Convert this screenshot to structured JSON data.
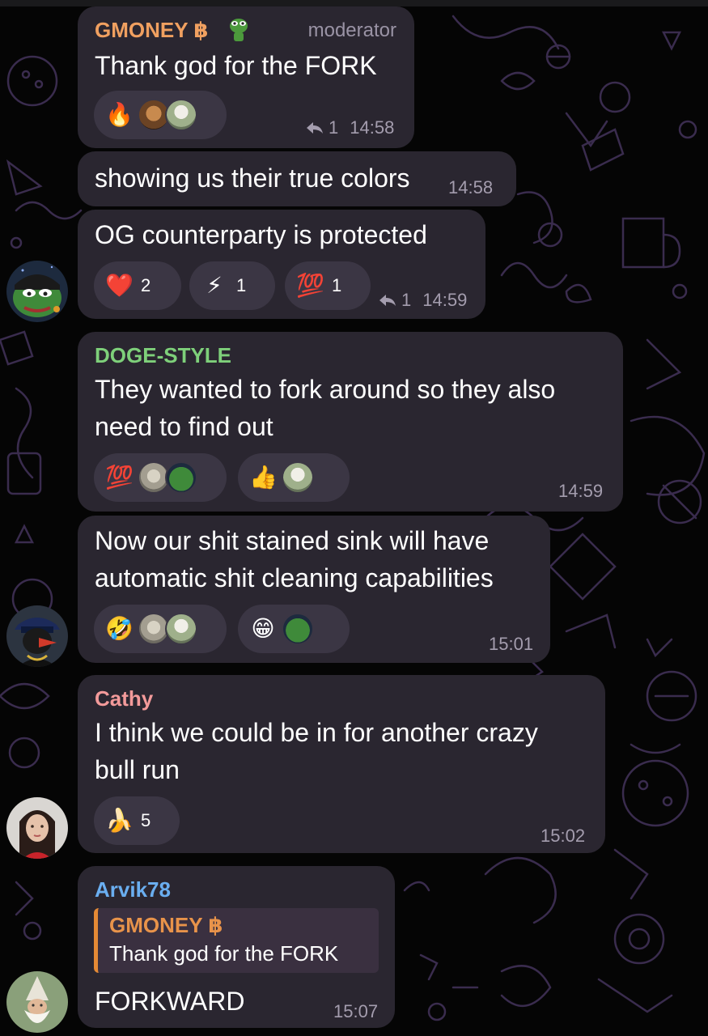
{
  "messages": [
    {
      "sender": "GMONEY ฿",
      "sender_color": "#f0a060",
      "role": "moderator",
      "text": "Thank god for the FORK",
      "replies": "1",
      "time": "14:58",
      "reactions": [
        {
          "emoji": "🔥",
          "voters": [
            "avatar-lion",
            "avatar-gnome"
          ]
        }
      ]
    },
    {
      "text": "showing us their true colors",
      "time": "14:58"
    },
    {
      "text": "OG counterparty is protected",
      "replies": "1",
      "time": "14:59",
      "reactions": [
        {
          "emoji": "❤️",
          "count": "2"
        },
        {
          "emoji": "⚡",
          "count": "1"
        },
        {
          "emoji": "💯",
          "count": "1"
        }
      ]
    },
    {
      "sender": "DOGE-STYLE",
      "sender_color": "#7ed07a",
      "lines": [
        "They wanted to fork around so they also",
        "need to find out"
      ],
      "time": "14:59",
      "reactions": [
        {
          "emoji": "💯",
          "voters": [
            "avatar-blur",
            "avatar-pepe"
          ]
        },
        {
          "emoji": "👍",
          "voters": [
            "avatar-gnome"
          ]
        }
      ]
    },
    {
      "lines": [
        "Now our shit stained sink will have",
        "automatic shit cleaning capabilities"
      ],
      "time": "15:01",
      "reactions": [
        {
          "emoji": "🤣",
          "voters": [
            "avatar-blur",
            "avatar-gnome"
          ]
        },
        {
          "emoji": "😁",
          "voters": [
            "avatar-pepe"
          ]
        }
      ]
    },
    {
      "sender": "Cathy",
      "sender_color": "#f39a9a",
      "lines": [
        "I think we could be in for another crazy",
        "bull run"
      ],
      "time": "15:02",
      "reactions": [
        {
          "emoji": "🍌",
          "count": "5"
        }
      ]
    },
    {
      "sender": "Arvik78",
      "sender_color": "#6aaef0",
      "quote": {
        "sender": "GMONEY ฿",
        "text": "Thank god for the FORK"
      },
      "text": "FORKWARD",
      "time": "15:07"
    }
  ],
  "colors": {
    "background": "#050505",
    "bubble": "#2a2630",
    "reaction_pill": "#3b3644",
    "doodle_stroke": "#3a2c4e"
  },
  "icons": [
    "reply-arrow-icon",
    "pepe-avatar",
    "gangster-avatar",
    "cathy-avatar",
    "gnome-avatar"
  ]
}
